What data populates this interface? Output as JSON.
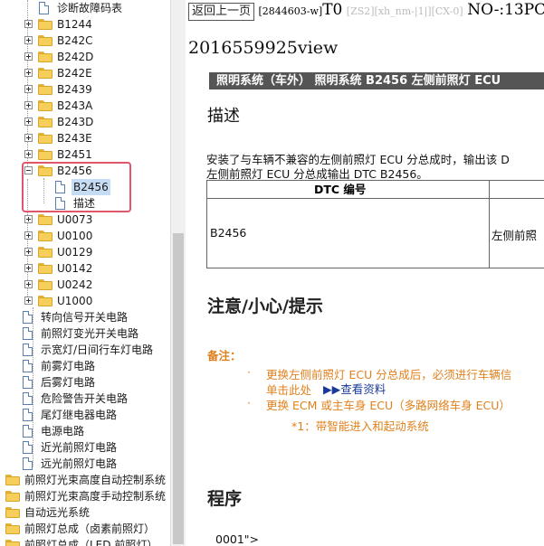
{
  "tree": {
    "items": [
      {
        "label": "诊断故障码表",
        "type": "doc"
      },
      {
        "label": "B1244",
        "type": "folder"
      },
      {
        "label": "B242C",
        "type": "folder"
      },
      {
        "label": "B242D",
        "type": "folder"
      },
      {
        "label": "B242E",
        "type": "folder"
      },
      {
        "label": "B2439",
        "type": "folder"
      },
      {
        "label": "B243A",
        "type": "folder"
      },
      {
        "label": "B243D",
        "type": "folder"
      },
      {
        "label": "B243E",
        "type": "folder"
      },
      {
        "label": "B2451",
        "type": "folder"
      },
      {
        "label": "B2456",
        "type": "folder"
      },
      {
        "label": "B2456",
        "type": "doc"
      },
      {
        "label": "描述",
        "type": "doc"
      },
      {
        "label": "U0073",
        "type": "folder"
      },
      {
        "label": "U0100",
        "type": "folder"
      },
      {
        "label": "U0129",
        "type": "folder"
      },
      {
        "label": "U0142",
        "type": "folder"
      },
      {
        "label": "U0242",
        "type": "folder"
      },
      {
        "label": "U1000",
        "type": "folder"
      },
      {
        "label": "转向信号开关电路",
        "type": "doc"
      },
      {
        "label": "前照灯变光开关电路",
        "type": "doc"
      },
      {
        "label": "示宽灯/日间行车灯电路",
        "type": "doc"
      },
      {
        "label": "前雾灯电路",
        "type": "doc"
      },
      {
        "label": "后雾灯电路",
        "type": "doc"
      },
      {
        "label": "危险警告开关电路",
        "type": "doc"
      },
      {
        "label": "尾灯继电器电路",
        "type": "doc"
      },
      {
        "label": "电源电路",
        "type": "doc"
      },
      {
        "label": "近光前照灯电路",
        "type": "doc"
      },
      {
        "label": "远光前照灯电路",
        "type": "doc"
      },
      {
        "label": "前照灯光束高度自动控制系统",
        "type": "folder"
      },
      {
        "label": "前照灯光束高度手动控制系统",
        "type": "folder"
      },
      {
        "label": "自动远光系统",
        "type": "folder"
      },
      {
        "label": "前照灯总成（卤素前照灯）",
        "type": "folder"
      },
      {
        "label": "前照灯总成（LED 前照灯）",
        "type": "folder"
      }
    ]
  },
  "topbar": {
    "back_label": "返回上一页",
    "doc_id": "[2844603-w]",
    "code": "T0",
    "tags": "[ZS2][xh_nm-|1|][CX-0]",
    "no": "NO-:13PC"
  },
  "content": {
    "view_id": "2016559925view",
    "banner": "照明系统（车外） 照明系统 B2456 左侧前照灯 ECU",
    "desc_heading": "描述",
    "desc_line1": "安装了与车辆不兼容的左侧前照灯 ECU 分总成时，输出该 D",
    "desc_line2": "左侧前照灯 ECU 分总成输出 DTC B2456。",
    "table_header": "DTC 编号",
    "table_cell_code": "B2456",
    "table_cell_desc": "左侧前照",
    "caution_heading": "注意/小心/提示",
    "note_label": "备注：",
    "bullet1": "更换左侧前照灯 ECU 分总成后，必须进行车辆信",
    "bullet1_cont": "单击此处",
    "link_text": "▶▶查看资料",
    "bullet2": "更换 ECM 或主车身 ECU（多路网络车身 ECU）",
    "footnote": "*1：带智能进入和起动系统",
    "proc_heading": "程序",
    "step": "0001\">"
  }
}
